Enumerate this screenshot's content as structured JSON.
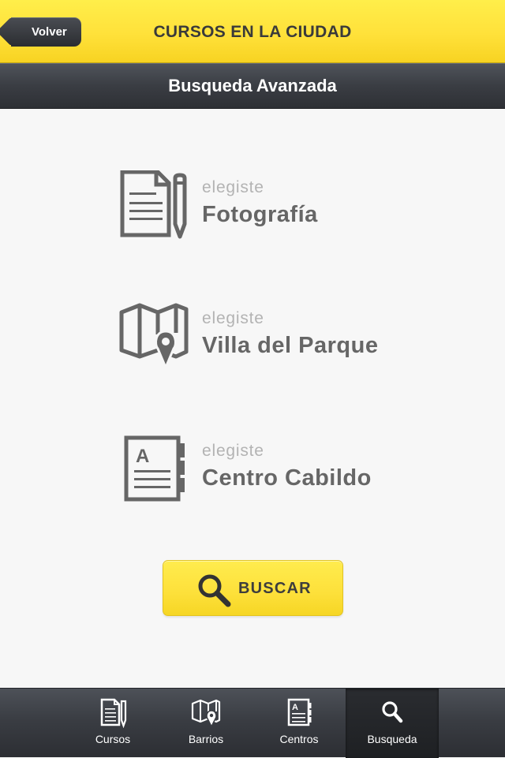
{
  "header": {
    "back_label": "Volver",
    "title": "CURSOS EN LA CIUDAD",
    "subtitle": "Busqueda Avanzada"
  },
  "selections": [
    {
      "icon": "document-pencil-icon",
      "caption": "elegiste",
      "value": "Fotografía"
    },
    {
      "icon": "map-pin-icon",
      "caption": "elegiste",
      "value": "Villa del Parque"
    },
    {
      "icon": "address-book-icon",
      "caption": "elegiste",
      "value": "Centro Cabildo"
    }
  ],
  "search_button": {
    "icon": "magnifier-icon",
    "label": "BUSCAR"
  },
  "tabs": [
    {
      "icon": "document-pencil-icon",
      "label": "Cursos",
      "active": false
    },
    {
      "icon": "map-pin-icon",
      "label": "Barrios",
      "active": false
    },
    {
      "icon": "address-book-icon",
      "label": "Centros",
      "active": false
    },
    {
      "icon": "magnifier-icon",
      "label": "Busqueda",
      "active": true
    }
  ],
  "colors": {
    "accent_yellow": "#ffe13a",
    "dark_bar": "#3a3d43",
    "icon_gray": "#666666",
    "caption_gray": "#b3b3b3"
  }
}
